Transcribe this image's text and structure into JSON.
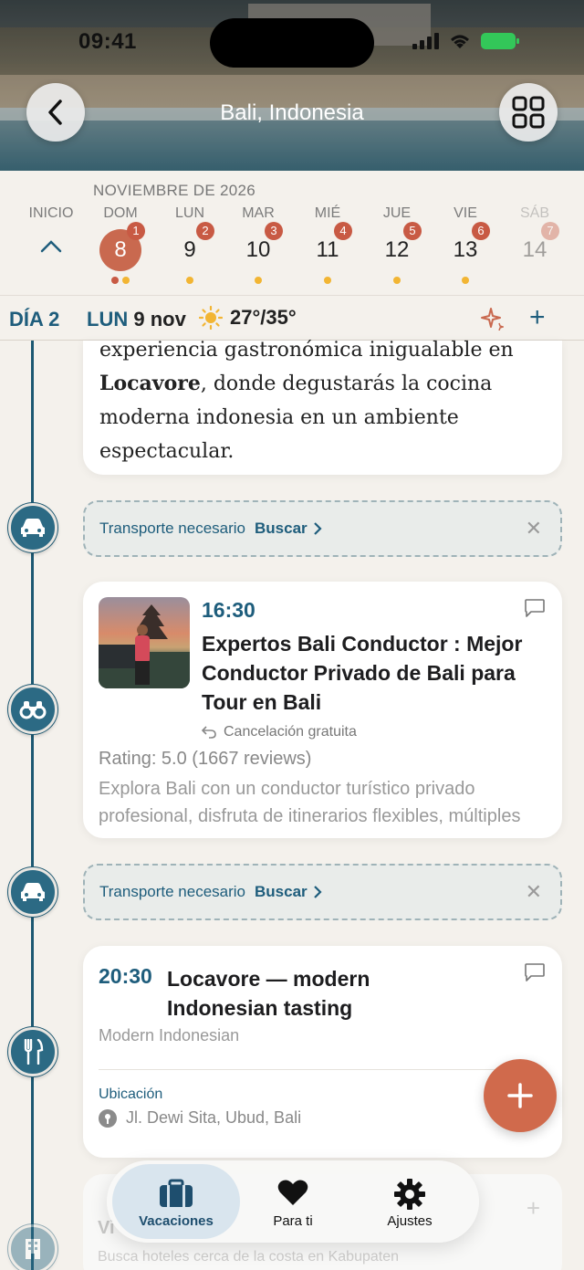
{
  "status": {
    "time": "09:41"
  },
  "header": {
    "title": "Bali, Indonesia"
  },
  "calendar": {
    "month": "NOVIEMBRE DE 2026",
    "start_label": "INICIO",
    "days": [
      {
        "dow": "DOM",
        "num": "8",
        "badge": "1",
        "selected": true
      },
      {
        "dow": "LUN",
        "num": "9",
        "badge": "2"
      },
      {
        "dow": "MAR",
        "num": "10",
        "badge": "3"
      },
      {
        "dow": "MIÉ",
        "num": "11",
        "badge": "4"
      },
      {
        "dow": "JUE",
        "num": "12",
        "badge": "5"
      },
      {
        "dow": "VIE",
        "num": "13",
        "badge": "6"
      },
      {
        "dow": "SÁB",
        "num": "14",
        "badge": "7"
      }
    ]
  },
  "day_header": {
    "day": "DÍA 2",
    "dow": "LUN",
    "date": "9 nov",
    "weather": "27°/35°"
  },
  "description": {
    "line1": "experiencia gastronómica inigualable en",
    "bold": "Locavore",
    "rest": ", donde degustarás la cocina moderna indonesia en un ambiente espectacular."
  },
  "transport": {
    "label": "Transporte necesario",
    "action": "Buscar"
  },
  "activity": {
    "time": "16:30",
    "title": "Expertos Bali Conductor : Mejor Conductor Privado de Bali para Tour en Bali",
    "cancellation": "Cancelación gratuita",
    "rating": "Rating: 5.0 (1667 reviews)",
    "desc_line1": "Explora Bali con un conductor turístico privado",
    "desc_line2": "profesional, disfruta de itinerarios flexibles, múltiples"
  },
  "restaurant": {
    "time": "20:30",
    "title": "Locavore — modern Indonesian tasting",
    "cuisine": "Modern Indonesian",
    "location_label": "Ubicación",
    "address": "Jl. Dewi Sita, Ubud, Bali"
  },
  "ghost": {
    "title": "Vi",
    "subtitle": "Busca hoteles cerca de la costa en Kabupaten"
  },
  "tabs": [
    {
      "label": "Vacaciones",
      "icon": "suitcase-icon",
      "active": true
    },
    {
      "label": "Para ti",
      "icon": "heart-icon"
    },
    {
      "label": "Ajustes",
      "icon": "gear-icon"
    }
  ],
  "colors": {
    "accent": "#1e5d7c",
    "badge": "#c85a44",
    "fab": "#d06a4c",
    "dot": "#f2b533"
  }
}
